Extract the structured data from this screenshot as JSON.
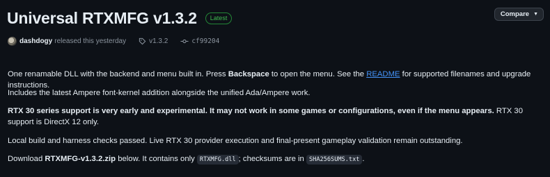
{
  "release": {
    "title": "Universal RTXMFG v1.3.2",
    "badge": "Latest",
    "compare_label": "Compare",
    "author": "dashdogy",
    "released_text": "released this yesterday",
    "tag": "v1.3.2",
    "commit": "cf99204"
  },
  "notes": {
    "p1": {
      "a": "One renamable DLL with the backend and menu built in. Press ",
      "key": "Backspace",
      "b": " to open the menu. See the ",
      "link": "README",
      "c": " for supported filenames and upgrade instructions."
    },
    "p2": "Includes the latest Ampere font-kernel addition alongside the unified Ada/Ampere work.",
    "p3": {
      "bold": "RTX 30 series support is very early and experimental. It may not work in some games or configurations, even if the menu appears.",
      "rest": " RTX 30 support is DirectX 12 only."
    },
    "p4": "Local build and harness checks passed. Live RTX 30 provider execution and final-present gameplay validation remain outstanding.",
    "p5": {
      "a": "Download ",
      "file": "RTXMFG-v1.3.2.zip",
      "b": " below. It contains only ",
      "code1": "RTXMFG.dll",
      "c": "; checksums are in ",
      "code2": "SHA256SUMS.txt",
      "d": "."
    }
  },
  "colors": {
    "background": "#0d1117",
    "text": "#e6edf3",
    "muted": "#8b949e",
    "link": "#4493f8",
    "latest_badge": "#3fb950"
  }
}
